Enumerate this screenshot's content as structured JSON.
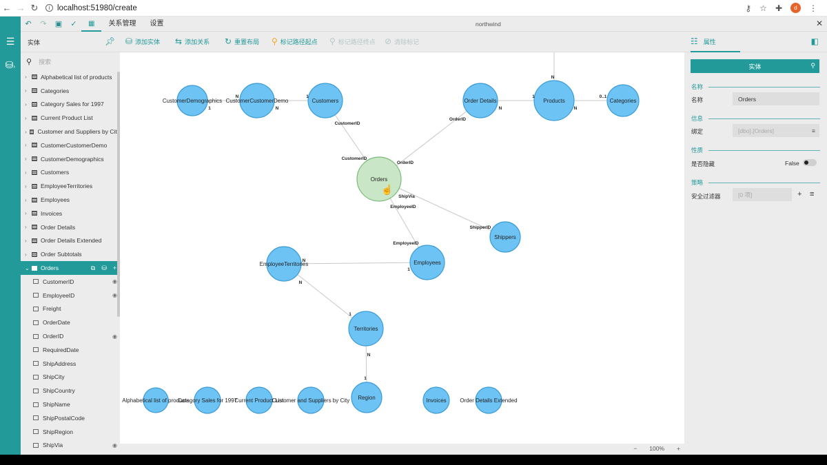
{
  "browser": {
    "url": "localhost:51980/create",
    "avatar": "d"
  },
  "menubar": {
    "tabs": [
      "关系管理",
      "设置"
    ],
    "doc_title": "northwind"
  },
  "toolbar": {
    "entity_label": "实体",
    "add_entity": "添加实体",
    "add_relation": "添加关系",
    "relayout": "重置布局",
    "mark_start": "标记路径起点",
    "mark_end": "标记路径终点",
    "clear_mark": "清除标记",
    "props_label": "属性"
  },
  "sidebar": {
    "search_placeholder": "搜索",
    "items_before": [
      "Alphabetical list of products",
      "Categories",
      "Category Sales for 1997",
      "Current Product List",
      "Customer and Suppliers by City",
      "CustomerCustomerDemo",
      "CustomerDemographics",
      "Customers",
      "EmployeeTerritories",
      "Employees",
      "Invoices",
      "Order Details",
      "Order Details Extended",
      "Order Subtotals"
    ],
    "selected": "Orders",
    "fields": [
      {
        "name": "CustomerID",
        "key": true
      },
      {
        "name": "EmployeeID",
        "key": true
      },
      {
        "name": "Freight",
        "key": false
      },
      {
        "name": "OrderDate",
        "key": false
      },
      {
        "name": "OrderID",
        "key": true
      },
      {
        "name": "RequiredDate",
        "key": false
      },
      {
        "name": "ShipAddress",
        "key": false
      },
      {
        "name": "ShipCity",
        "key": false
      },
      {
        "name": "ShipCountry",
        "key": false
      },
      {
        "name": "ShipName",
        "key": false
      },
      {
        "name": "ShipPostalCode",
        "key": false
      },
      {
        "name": "ShipRegion",
        "key": false
      },
      {
        "name": "ShipVia",
        "key": true
      }
    ]
  },
  "diagram": {
    "nodes": [
      {
        "id": "CustomerDemographics",
        "label": "CustomerDemographics"
      },
      {
        "id": "CustomerCustomerDemo",
        "label": "CustomerCustomerDemo"
      },
      {
        "id": "Customers",
        "label": "Customers"
      },
      {
        "id": "OrderDetails",
        "label": "Order Details"
      },
      {
        "id": "Products",
        "label": "Products"
      },
      {
        "id": "Categories",
        "label": "Categories"
      },
      {
        "id": "Orders",
        "label": "Orders",
        "selected": true
      },
      {
        "id": "Shippers",
        "label": "Shippers"
      },
      {
        "id": "EmployeeTerritories",
        "label": "EmployeeTerritories"
      },
      {
        "id": "Employees",
        "label": "Employees"
      },
      {
        "id": "Territories",
        "label": "Territories"
      },
      {
        "id": "Region",
        "label": "Region"
      },
      {
        "id": "AlphaList",
        "label": "Alphabetical list of products"
      },
      {
        "id": "CatSales",
        "label": "Category Sales for 1997"
      },
      {
        "id": "CurProd",
        "label": "Current Product List"
      },
      {
        "id": "CustSupp",
        "label": "Customer and Suppliers by City"
      },
      {
        "id": "Invoices",
        "label": "Invoices"
      },
      {
        "id": "ODExt",
        "label": "Order Details Extended"
      }
    ],
    "edges": [
      {
        "from": "CustomerCustomerDemo",
        "to": "CustomerDemographics",
        "from_card": "N",
        "to_card": "1",
        "extra_card": "N"
      },
      {
        "from": "CustomerCustomerDemo",
        "to": "Customers",
        "from_card": "N",
        "to_card": "1"
      },
      {
        "from": "Orders",
        "to": "Customers",
        "label": "CustomerID"
      },
      {
        "from": "Orders",
        "to": "OrderDetails",
        "label": "OrderID"
      },
      {
        "from": "OrderDetails",
        "to": "Products",
        "from_card": "N",
        "to_card": "1"
      },
      {
        "from": "Products",
        "to": "Categories",
        "from_card": "N",
        "to_card": "0..1"
      },
      {
        "from": "Orders",
        "to": "Shippers",
        "label": "ShipVia",
        "to_label": "ShipperID"
      },
      {
        "from": "Orders",
        "to": "Employees",
        "label": "EmployeeID",
        "to_label": "EmployeeID",
        "to_card": "1"
      },
      {
        "from": "EmployeeTerritories",
        "to": "Employees",
        "from_card": "N"
      },
      {
        "from": "EmployeeTerritories",
        "to": "Territories",
        "from_card": "N",
        "to_card": "1"
      },
      {
        "from": "Territories",
        "to": "Region",
        "from_card": "N",
        "to_card": "1"
      },
      {
        "from": "Products",
        "to": "offscreen",
        "from_card": "N"
      }
    ],
    "orders_labels": {
      "customer": "CustomerID",
      "order": "OrderID",
      "shipvia": "ShipVia",
      "employee": "EmployeeID"
    }
  },
  "status": {
    "zoom": "100%"
  },
  "properties": {
    "header": "实体",
    "sec_name": "名称",
    "name_label": "名称",
    "name_value": "Orders",
    "sec_info": "信息",
    "bind_label": "绑定",
    "bind_value": "[dbo].[Orders]",
    "sec_prop": "性质",
    "hidden_label": "是否隐藏",
    "hidden_value": "False",
    "sec_filter": "策略",
    "filter_label": "安全过滤器",
    "filter_value": "[0 项]"
  }
}
